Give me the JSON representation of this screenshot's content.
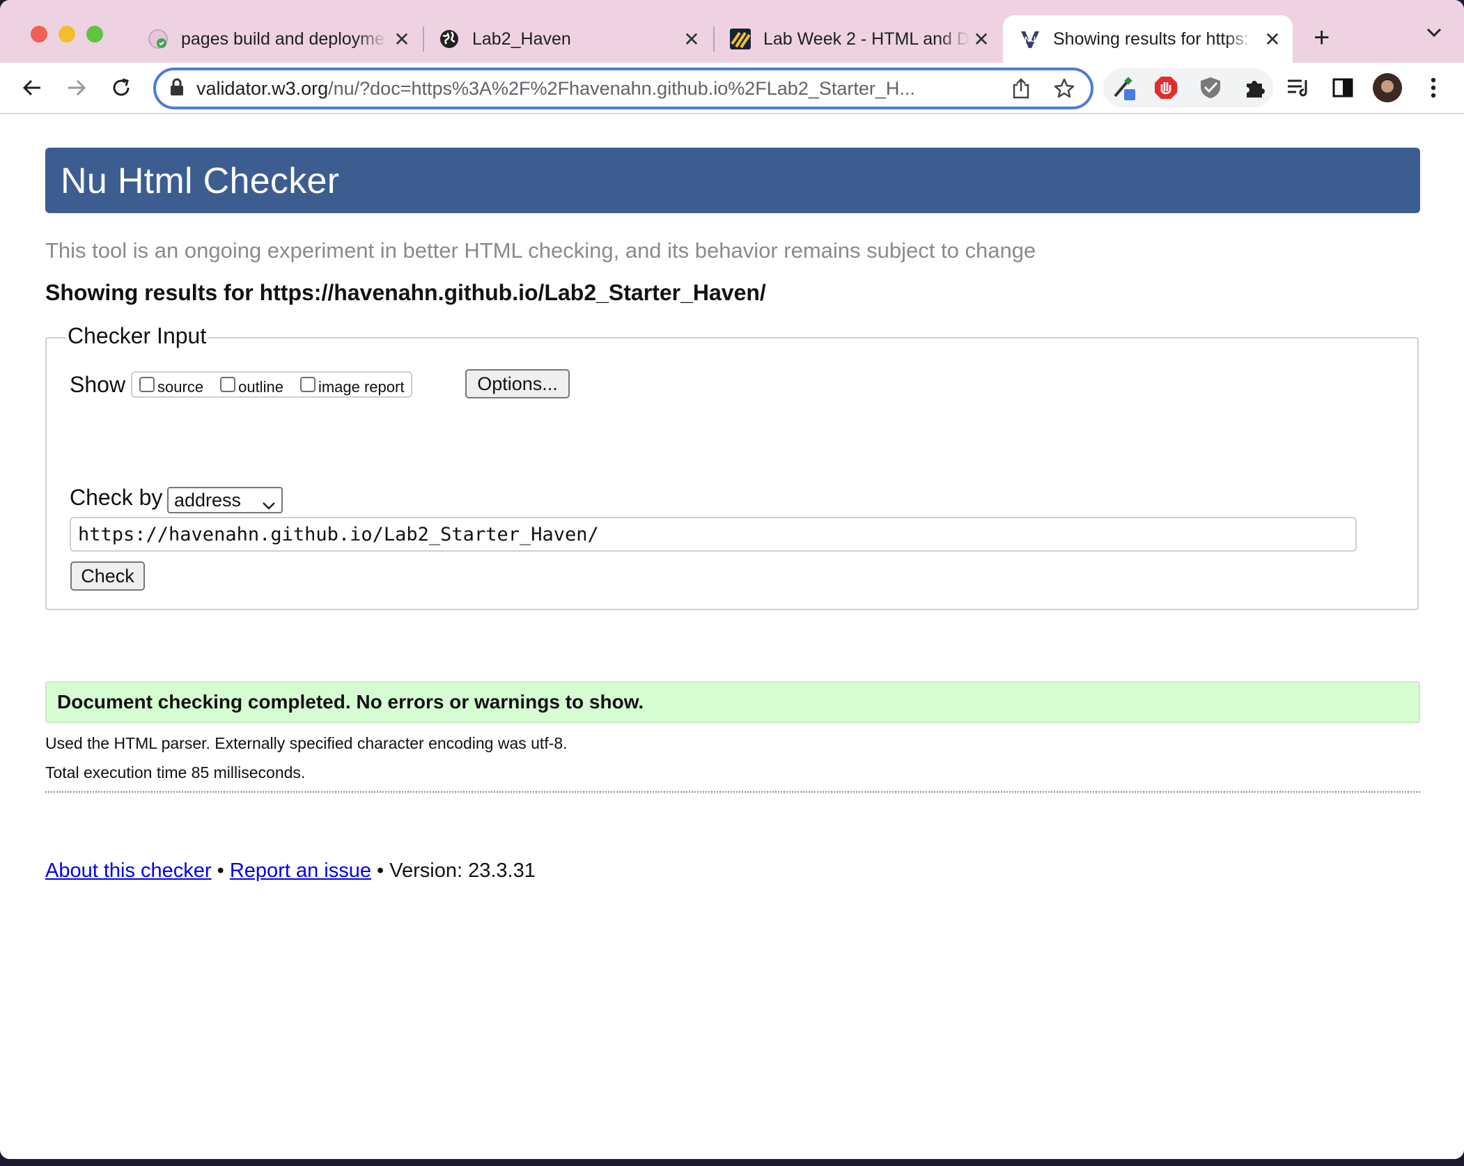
{
  "browser": {
    "tabs": [
      {
        "title": "pages build and deployme",
        "icon": "github-icon",
        "active": false
      },
      {
        "title": "Lab2_Haven",
        "icon": "globe-icon",
        "active": false
      },
      {
        "title": "Lab Week 2 - HTML and D",
        "icon": "canvas-icon",
        "active": false
      },
      {
        "title": "Showing results for https:",
        "icon": "w3c-nu-icon",
        "active": true
      }
    ],
    "address": {
      "host": "validator.w3.org",
      "path": "/nu/?doc=https%3A%2F%2Fhavenahn.github.io%2FLab2_Starter_H..."
    }
  },
  "page": {
    "title": "Nu Html Checker",
    "tagline": "This tool is an ongoing experiment in better HTML checking, and its behavior remains subject to change",
    "results_heading": "Showing results for https://havenahn.github.io/Lab2_Starter_Haven/",
    "checker_input": {
      "legend": "Checker Input",
      "show_label": "Show",
      "checkboxes": [
        {
          "label": "source",
          "checked": false
        },
        {
          "label": "outline",
          "checked": false
        },
        {
          "label": "image report",
          "checked": false
        }
      ],
      "options_button": "Options...",
      "check_by_label": "Check by",
      "check_by_value": "address",
      "url_value": "https://havenahn.github.io/Lab2_Starter_Haven/",
      "check_button": "Check"
    },
    "status_message": "Document checking completed. No errors or warnings to show.",
    "parser_info": "Used the HTML parser. Externally specified character encoding was utf-8.",
    "execution_time": "Total execution time 85 milliseconds.",
    "footer": {
      "about_link": "About this checker",
      "report_link": "Report an issue",
      "separator": " • ",
      "version": "Version: 23.3.31"
    },
    "colors": {
      "banner": "#3d5d91",
      "success_bg": "#d6fcd2",
      "tab_strip": "#eed2e2"
    }
  }
}
